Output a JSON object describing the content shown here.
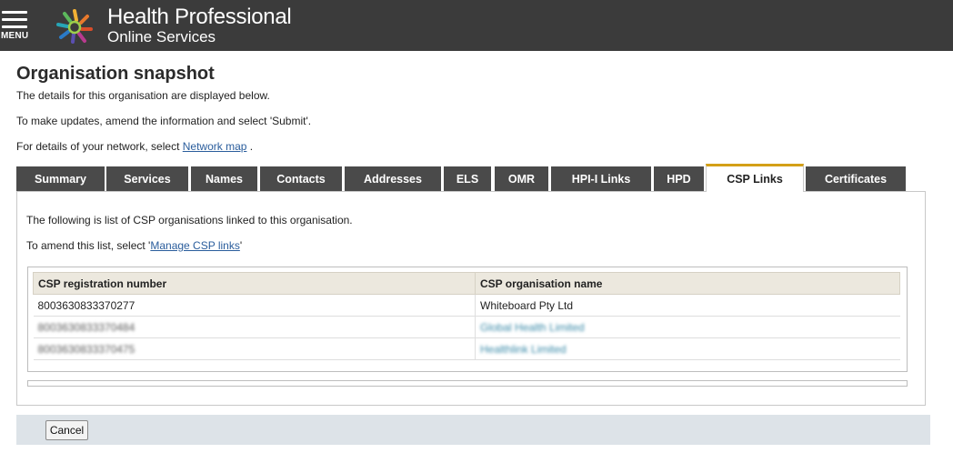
{
  "header": {
    "menu_label": "MENU",
    "brand_line1": "Health Professional",
    "brand_line2": "Online Services",
    "icons": {
      "menu": "hamburger-icon",
      "logo": "star-logo-icon"
    }
  },
  "intro": {
    "title": "Organisation snapshot",
    "line1": "The details for this organisation are displayed below.",
    "line2": "To make updates, amend the information and select 'Submit'.",
    "line3_prefix": "For details of your network, select ",
    "line3_link": "Network map",
    "line3_suffix": " ."
  },
  "tabs": [
    {
      "label": "Summary"
    },
    {
      "label": "Services"
    },
    {
      "label": "Names"
    },
    {
      "label": "Contacts"
    },
    {
      "label": "Addresses"
    },
    {
      "label": "ELS"
    },
    {
      "label": "OMR"
    },
    {
      "label": "HPI-I Links"
    },
    {
      "label": "HPD"
    },
    {
      "label": "CSP Links",
      "active": true
    },
    {
      "label": "Certificates"
    }
  ],
  "panel": {
    "text1": "The following is list of CSP organisations linked to this organisation.",
    "text2_prefix": "To amend this list, select '",
    "text2_link": "Manage CSP links",
    "text2_suffix": "'",
    "table": {
      "headers": [
        "CSP registration number",
        "CSP organisation name"
      ],
      "rows": [
        [
          "8003630833370277",
          "Whiteboard Pty Ltd"
        ],
        [
          "8003630833370484",
          "Global Health Limited"
        ],
        [
          "8003630833370475",
          "Healthlink Limited"
        ]
      ]
    }
  },
  "footer": {
    "cancel_label": "Cancel"
  },
  "colors": {
    "topbar": "#3b3b3b",
    "tab": "#4a4a4a",
    "tab_active_accent": "#d4a017",
    "link": "#2a5d9c",
    "footer": "#dde3e8",
    "table_header": "#ece8de"
  }
}
